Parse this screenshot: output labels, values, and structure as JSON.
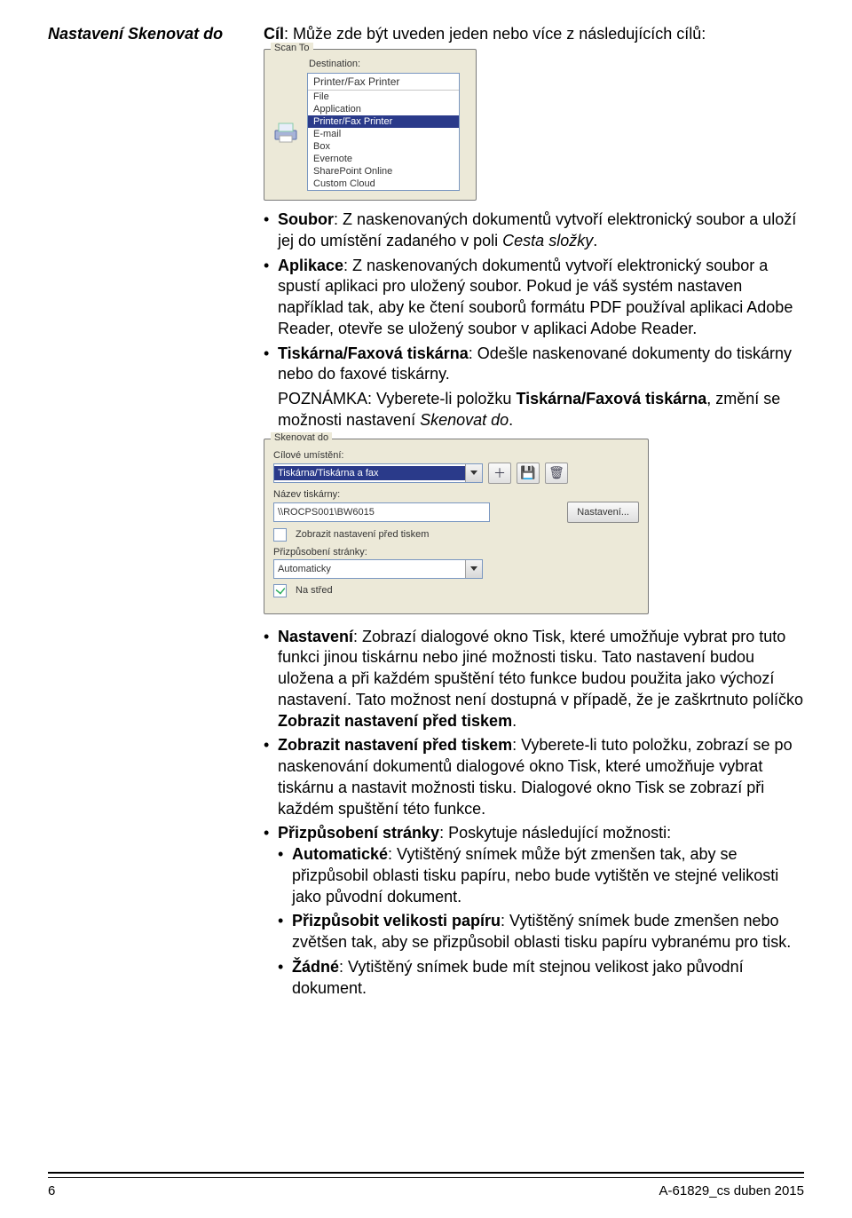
{
  "heading": {
    "left": "Nastavení Skenovat do",
    "right_bold": "Cíl",
    "right_rest": ": Může zde být uveden jeden nebo více z následujících cílů:"
  },
  "scan_to_1": {
    "group_title": "Scan To",
    "dest_label": "Destination:",
    "selected": "Printer/Fax Printer",
    "options": [
      "File",
      "Application",
      "Printer/Fax Printer",
      "E-mail",
      "Box",
      "Evernote",
      "SharePoint Online",
      "Custom Cloud"
    ]
  },
  "bullets1": {
    "soubor_b": "Soubor",
    "soubor_txt": ": Z naskenovaných dokumentů vytvoří elektronický soubor a uloží jej do umístění zadaného v poli ",
    "soubor_em": "Cesta složky",
    "soubor_end": ".",
    "aplikace_b": "Aplikace",
    "aplikace_txt": ": Z naskenovaných dokumentů vytvoří elektronický soubor a spustí aplikaci pro uložený soubor. Pokud je váš systém nastaven například tak, aby ke čtení souborů formátu PDF používal aplikaci Adobe Reader, otevře se uložený soubor v aplikaci Adobe Reader.",
    "tisk_b": "Tiskárna/Faxová tiskárna",
    "tisk_txt": ": Odešle naskenované dokumenty do tiskárny nebo do faxové tiskárny.",
    "pozn_lead": "POZNÁMKA: ",
    "pozn_pre": "Vyberete-li položku ",
    "pozn_b": "Tiskárna/Faxová tiskárna",
    "pozn_mid": ", změní se možnosti nastavení ",
    "pozn_em": "Skenovat do",
    "pozn_end": "."
  },
  "scan_to_2": {
    "group_title": "Skenovat do",
    "dest_label": "Cílové umístění:",
    "dest_value": "Tiskárna/Tiskárna a fax",
    "printer_label": "Název tiskárny:",
    "printer_value": "\\\\ROCPS001\\BW6015",
    "settings_btn": "Nastavení...",
    "show_before_print": "Zobrazit nastavení před tiskem",
    "pagefit_label": "Přizpůsobení stránky:",
    "pagefit_value": "Automaticky",
    "center_label": "Na střed"
  },
  "dashes": {
    "d1_b": "Nastavení",
    "d1_txt": ": Zobrazí dialogové okno Tisk, které umožňuje vybrat pro tuto funkci jinou tiskárnu nebo jiné možnosti tisku. Tato nastavení budou uložena a při každém spuštění této funkce budou použita jako výchozí nastavení. Tato možnost není dostupná v případě, že je zaškrtnuto políčko ",
    "d1_b2": "Zobrazit nastavení před tiskem",
    "d1_end": ".",
    "d2_b": "Zobrazit nastavení před tiskem",
    "d2_txt": ": Vyberete-li tuto položku, zobrazí se po naskenování dokumentů dialogové okno Tisk, které umožňuje vybrat tiskárnu a nastavit možnosti tisku. Dialogové okno Tisk se zobrazí při každém spuštění této funkce.",
    "d3_b": "Přizpůsobení stránky",
    "d3_txt": ": Poskytuje následující možnosti:",
    "s1_b": "Automatické",
    "s1_txt": ": Vytištěný snímek může být zmenšen tak, aby se přizpůsobil oblasti tisku papíru, nebo bude vytištěn ve stejné velikosti jako původní dokument.",
    "s2_b": "Přizpůsobit velikosti papíru",
    "s2_txt": ": Vytištěný snímek bude zmenšen nebo zvětšen tak, aby se přizpůsobil oblasti tisku papíru vybranému pro tisk.",
    "s3_b": "Žádné",
    "s3_txt": ": Vytištěný snímek bude mít stejnou velikost jako původní dokument."
  },
  "footer": {
    "page": "6",
    "right": "A-61829_cs  duben 2015"
  }
}
